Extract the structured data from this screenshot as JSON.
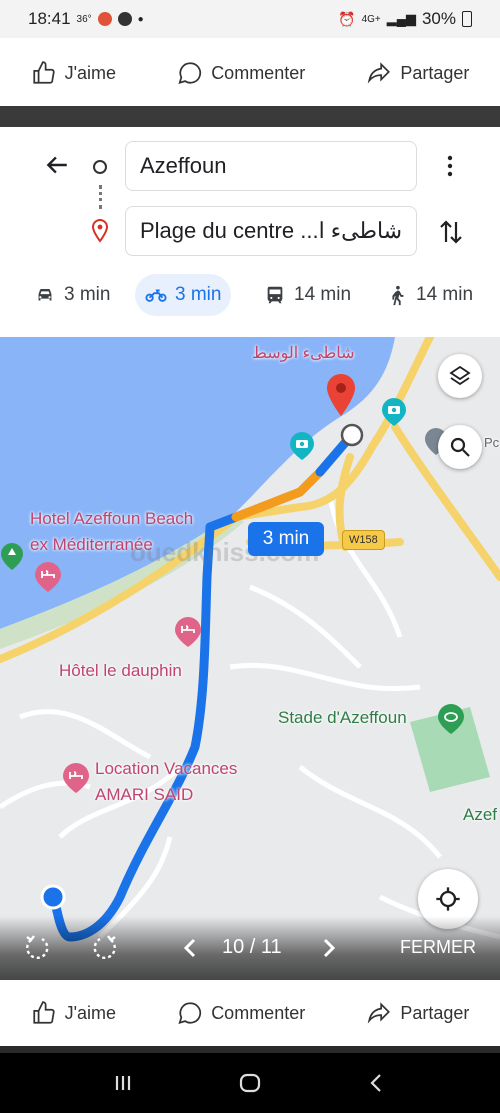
{
  "status_bar": {
    "time": "18:41",
    "temperature": "36°",
    "network": "4G+",
    "battery": "30%"
  },
  "social_bar": {
    "like_label": "J'aime",
    "comment_label": "Commenter",
    "share_label": "Partager"
  },
  "directions": {
    "origin": "Azeffoun",
    "destination": "Plage du centre ...شاطىء ا",
    "modes": [
      {
        "icon": "car-icon",
        "label": "3 min",
        "selected": false
      },
      {
        "icon": "motorcycle-icon",
        "label": "3 min",
        "selected": true
      },
      {
        "icon": "transit-icon",
        "label": "14 min",
        "selected": false
      },
      {
        "icon": "walk-icon",
        "label": "14 min",
        "selected": false
      }
    ]
  },
  "map": {
    "labels": {
      "beach_arabic": "شاطىء الوسط",
      "hotel_beach_line1": "Hotel Azeffoun Beach",
      "hotel_beach_line2": "ex Méditerranée",
      "hotel_dauphin": "Hôtel le dauphin",
      "location_line1": "Location Vacances",
      "location_line2": "AMARI SAID",
      "stadium": "Stade d'Azeffoun",
      "azeffoun_edge": "Azef",
      "watermark": "ouedkniss.com",
      "pc_edge": "Pc"
    },
    "route_time": "3 min",
    "road_badge": "W158",
    "colors": {
      "water": "#8ab4f8",
      "route": "#1a73e8",
      "traffic": "#f29b1d",
      "road_major": "#f6d26a",
      "pin": "#ea4335"
    }
  },
  "viewer": {
    "counter": "10 / 11",
    "close_label": "FERMER"
  }
}
